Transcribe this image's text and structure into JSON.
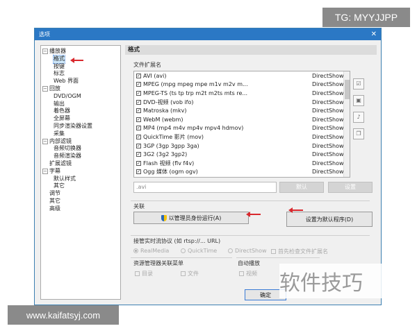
{
  "watermarks": {
    "tg": "TG: MYYJJPP",
    "url": "www.kaifatsyj.com",
    "site": "软件技巧"
  },
  "window": {
    "title": "选项",
    "close_glyph": "✕"
  },
  "tree": {
    "items": [
      {
        "label": "播放器",
        "level": 0,
        "toggle": "−"
      },
      {
        "label": "格式",
        "level": 1,
        "selected": true
      },
      {
        "label": "按键",
        "level": 1
      },
      {
        "label": "标志",
        "level": 1
      },
      {
        "label": "Web 界面",
        "level": 1
      },
      {
        "label": "回放",
        "level": 0,
        "toggle": "−"
      },
      {
        "label": "DVD/OGM",
        "level": 1
      },
      {
        "label": "输出",
        "level": 1
      },
      {
        "label": "着色器",
        "level": 1
      },
      {
        "label": "全屏幕",
        "level": 1
      },
      {
        "label": "同步渲染器设置",
        "level": 1
      },
      {
        "label": "采集",
        "level": 1
      },
      {
        "label": "内部滤镜",
        "level": 0,
        "toggle": "−"
      },
      {
        "label": "音频切换器",
        "level": 1
      },
      {
        "label": "音频渲染器",
        "level": 1
      },
      {
        "label": "扩展滤镜",
        "level": 0
      },
      {
        "label": "字幕",
        "level": 0,
        "toggle": "−"
      },
      {
        "label": "默认样式",
        "level": 1
      },
      {
        "label": "其它",
        "level": 1
      },
      {
        "label": "调节",
        "level": 0
      },
      {
        "label": "其它",
        "level": 0
      },
      {
        "label": "高级",
        "level": 0
      }
    ]
  },
  "panel": {
    "title": "格式",
    "extensions_label": "文件扩展名",
    "extensions": [
      {
        "name": "AVI (avi)",
        "filter": "DirectShow"
      },
      {
        "name": "MPEG (mpg mpeg mpe m1v m2v m...",
        "filter": "DirectShow"
      },
      {
        "name": "MPEG-TS (ts tp trp m2t m2ts mts re...",
        "filter": "DirectShow"
      },
      {
        "name": "DVD-视频 (vob ifo)",
        "filter": "DirectShow"
      },
      {
        "name": "Matroska (mkv)",
        "filter": "DirectShow"
      },
      {
        "name": "WebM (webm)",
        "filter": "DirectShow"
      },
      {
        "name": "MP4 (mp4 m4v mp4v mpv4 hdmov)",
        "filter": "DirectShow"
      },
      {
        "name": "QuickTime 影片 (mov)",
        "filter": "DirectShow"
      },
      {
        "name": "3GP (3gp 3gpp 3ga)",
        "filter": "DirectShow"
      },
      {
        "name": "3G2 (3g2 3gp2)",
        "filter": "DirectShow"
      },
      {
        "name": "Flash 视频 (flv f4v)",
        "filter": "DirectShow"
      },
      {
        "name": "Ogg 媒体 (ogm ogv)",
        "filter": "DirectShow"
      }
    ],
    "ext_value": ".avi",
    "default_button": "默认",
    "set_button": "设置",
    "assoc_label": "关联",
    "run_admin_button": "以管理员身份运行(A)",
    "set_default_button": "设置为默认程序(D)",
    "realtime_label": "接管实时流协议 (如 rtsp://... URL)",
    "realtime_options": [
      "RealMedia",
      "QuickTime",
      "DirectShow"
    ],
    "check_ext_label": "首先检查文件扩展名",
    "explorer_label": "资源管理器关联菜单",
    "explorer_dir": "目录",
    "explorer_file": "文件",
    "autoplay_label": "自动播放",
    "autoplay_video": "视频",
    "ok_button": "确定"
  }
}
